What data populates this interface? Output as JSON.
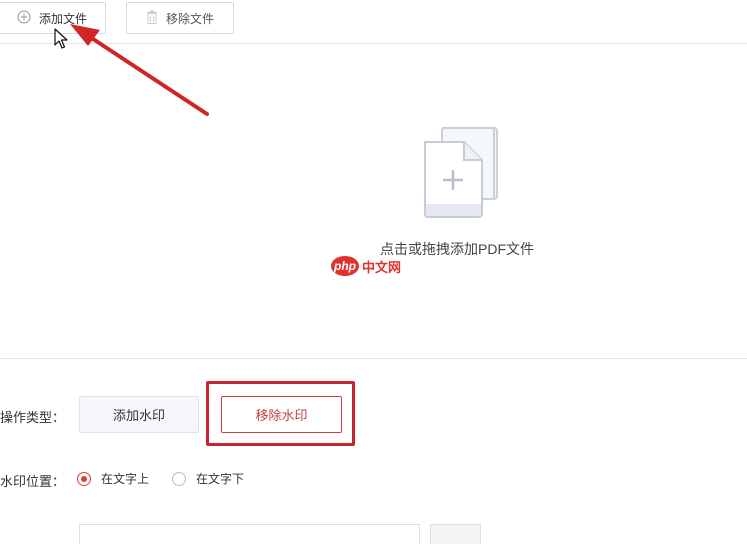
{
  "toolbar": {
    "add_file_label": "添加文件",
    "add_file_icon": "plus-circle-icon",
    "remove_file_label": "移除文件",
    "remove_file_icon": "trash-icon"
  },
  "drop_zone": {
    "hint": "点击或拖拽添加PDF文件",
    "icon": "add-document-icon"
  },
  "watermark": {
    "badge": "php",
    "text": "中文网"
  },
  "operation": {
    "label": "操作类型：",
    "options": [
      "添加水印",
      "移除水印"
    ],
    "selected": "移除水印"
  },
  "position": {
    "label": "水印位置：",
    "options": [
      "在文字上",
      "在文字下"
    ],
    "selected": "在文字上"
  },
  "colors": {
    "accent": "#d9413b",
    "highlight": "#c6262b",
    "arrow": "#d02626"
  }
}
